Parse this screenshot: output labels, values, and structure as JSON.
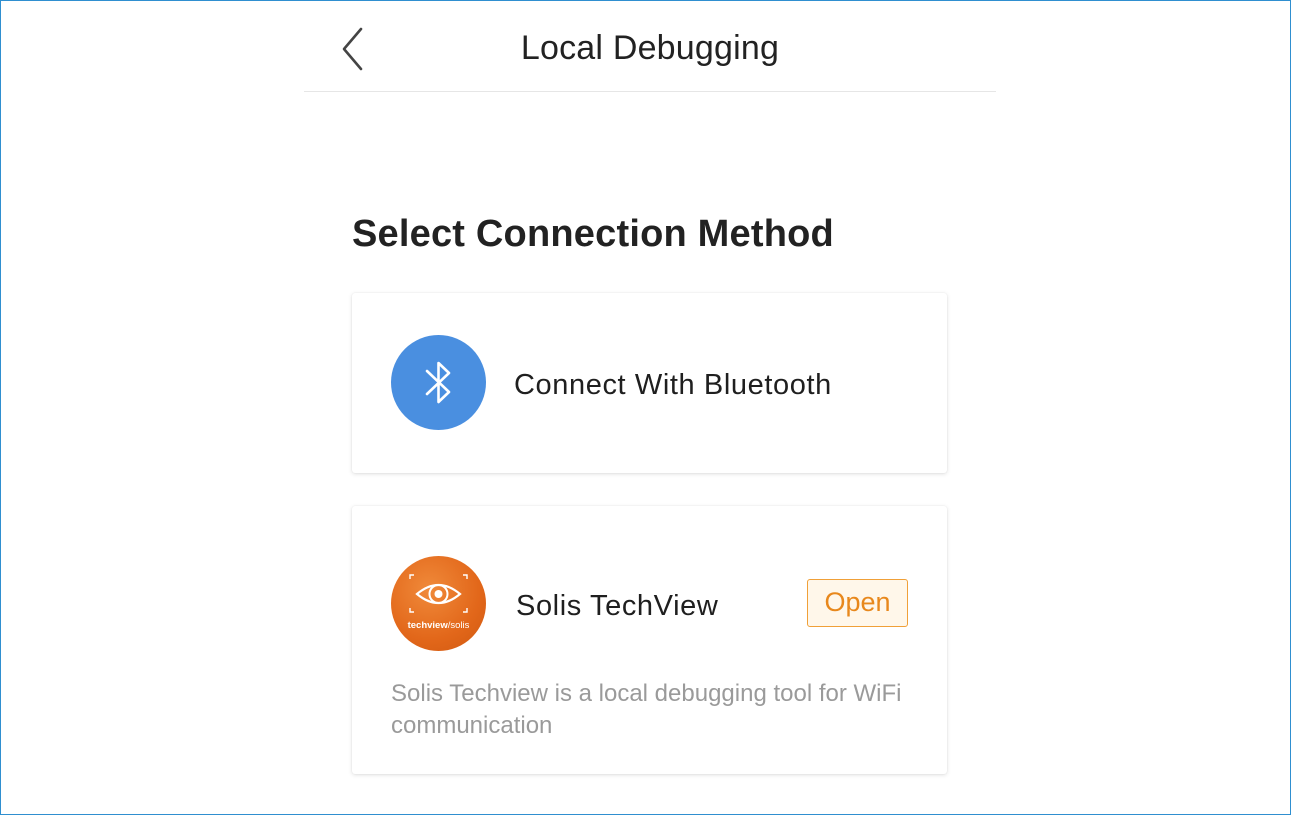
{
  "header": {
    "title": "Local Debugging",
    "back_icon": "chevron-left-icon"
  },
  "section": {
    "title": "Select Connection Method"
  },
  "bluetooth_card": {
    "label": "Connect With Bluetooth",
    "icon": "bluetooth-icon",
    "icon_color": "#4a8fe0"
  },
  "techview_card": {
    "label": "Solis TechView",
    "logo_text_bold": "techview",
    "logo_text_light": "/solis",
    "logo_icon": "eye-icon",
    "logo_color": "#e2671a",
    "open_label": "Open",
    "open_color": "#e8881c",
    "description": "Solis Techview is a local debugging tool for WiFi communication"
  }
}
